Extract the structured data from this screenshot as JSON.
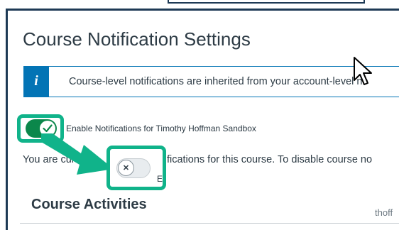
{
  "page": {
    "title": "Course Notification Settings",
    "section_title": "Course Activities",
    "watermark": "thoff"
  },
  "banner": {
    "icon": "info-icon",
    "text": "Course-level notifications are inherited from your account-level no"
  },
  "enable_toggle": {
    "state": "on",
    "label": "Enable Notifications for Timothy Hoffman Sandbox"
  },
  "notice": {
    "text_before": "You are cur",
    "text_after": "otifications for this course. To disable course no"
  },
  "annotation_toggle": {
    "state": "off",
    "label_fragment": "E"
  },
  "colors": {
    "accent": "#0374b5",
    "toggle_on": "#0b874b",
    "highlight": "#10b38a",
    "text": "#2d3b45"
  }
}
